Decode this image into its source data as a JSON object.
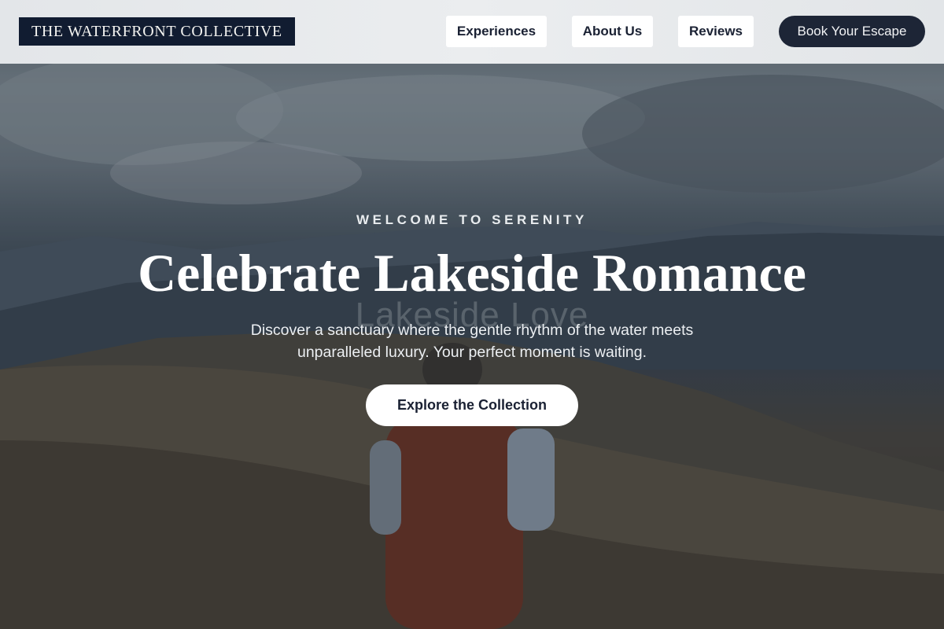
{
  "header": {
    "logo": "THE WATERFRONT COLLECTIVE",
    "nav": {
      "experiences": "Experiences",
      "about": "About Us",
      "reviews": "Reviews"
    },
    "cta": "Book Your Escape"
  },
  "hero": {
    "eyebrow": "WELCOME TO SERENITY",
    "title": "Celebrate Lakeside Romance",
    "ghost_text": "Lakeside Love",
    "subtitle": "Discover a sanctuary where the gentle rhythm of the water meets unparalleled luxury. Your perfect moment is waiting.",
    "cta": "Explore the Collection"
  },
  "colors": {
    "brand_dark": "#111c31",
    "button_dark": "#1d2536",
    "header_bg": "#e6e8eb"
  }
}
